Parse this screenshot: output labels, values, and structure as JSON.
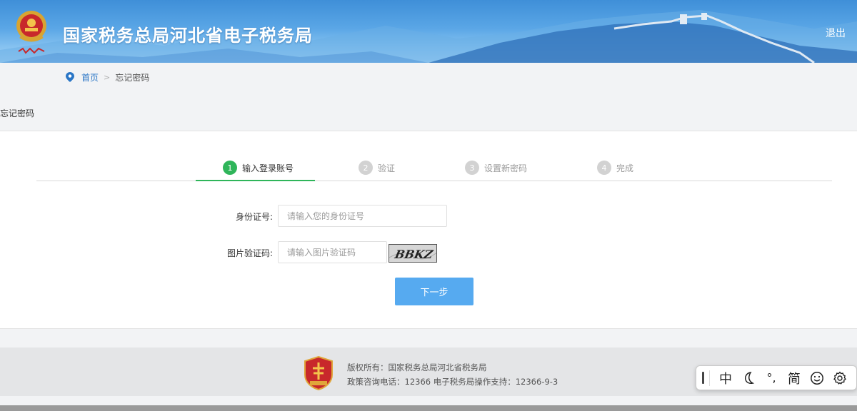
{
  "header": {
    "site_title": "国家税务总局河北省电子税务局",
    "logout_label": "退出"
  },
  "breadcrumb": {
    "home": "首页",
    "separator": ">",
    "current": "忘记密码"
  },
  "page_title": "忘记密码",
  "steps": [
    {
      "num": "1",
      "label": "输入登录账号",
      "active": true
    },
    {
      "num": "2",
      "label": "验证",
      "active": false
    },
    {
      "num": "3",
      "label": "设置新密码",
      "active": false
    },
    {
      "num": "4",
      "label": "完成",
      "active": false
    }
  ],
  "form": {
    "id_label": "身份证号:",
    "id_placeholder": "请输入您的身份证号",
    "captcha_label": "图片验证码:",
    "captcha_placeholder": "请输入图片验证码",
    "captcha_text": "BBKZ",
    "next_label": "下一步"
  },
  "footer": {
    "copyright": "版权所有：国家税务总局河北省税务局",
    "contact": "政策咨询电话：12366 电子税务局操作支持：12366-9-3"
  },
  "ime": {
    "mode": "中",
    "punct": "°,",
    "charset": "简"
  },
  "colors": {
    "accent_green": "#2fb55a",
    "button_blue": "#56aaf0",
    "link_blue": "#2a76c6"
  }
}
